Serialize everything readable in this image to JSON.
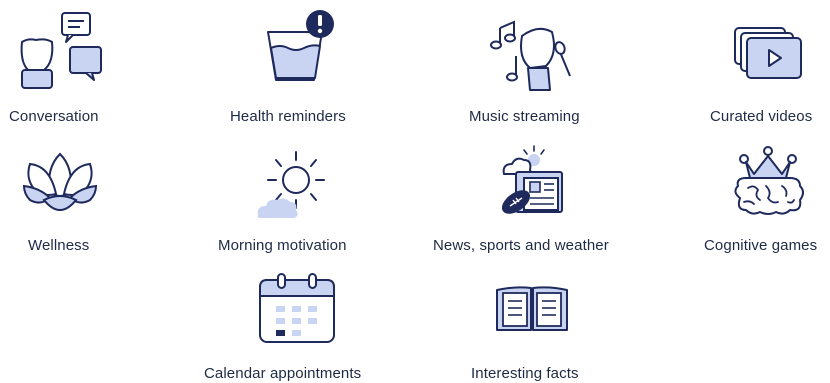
{
  "colors": {
    "stroke": "#1f2a5c",
    "fill_light": "#c9d3f2",
    "fill_mid": "#a9b6e6",
    "badge": "#1f2a5c",
    "text": "#1f2a44"
  },
  "features": [
    {
      "label": "Conversation",
      "icon": "conversation-icon"
    },
    {
      "label": "Health reminders",
      "icon": "health-reminder-icon"
    },
    {
      "label": "Music streaming",
      "icon": "music-icon"
    },
    {
      "label": "Curated videos",
      "icon": "video-icon"
    },
    {
      "label": "Wellness",
      "icon": "lotus-icon"
    },
    {
      "label": "Morning motivation",
      "icon": "sunrise-icon"
    },
    {
      "label": "News, sports and weather",
      "icon": "news-icon"
    },
    {
      "label": "Cognitive games",
      "icon": "brain-icon"
    },
    {
      "label": "Calendar appointments",
      "icon": "calendar-icon"
    },
    {
      "label": "Interesting facts",
      "icon": "book-icon"
    }
  ]
}
